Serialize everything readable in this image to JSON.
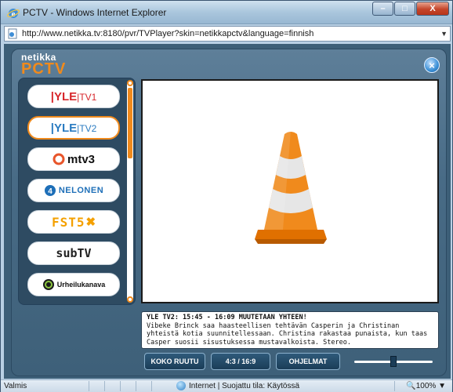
{
  "window": {
    "title": "PCTV - Windows Internet Explorer",
    "min_label": "–",
    "max_label": "□",
    "close_label": "X"
  },
  "addressbar": {
    "url": "http://www.netikka.tv:8180/pvr/TVPlayer?skin=netikkapctv&language=finnish"
  },
  "app": {
    "logo_small": "netikka",
    "logo_big": "PCTV",
    "close_label": "×",
    "channels": [
      {
        "name": "YLE TV1",
        "brand": "YLE",
        "suffix": "TV1",
        "selected": false
      },
      {
        "name": "YLE TV2",
        "brand": "YLE",
        "suffix": "TV2",
        "selected": true
      },
      {
        "name": "MTV3",
        "brand": "mtv3",
        "suffix": "",
        "selected": false
      },
      {
        "name": "NELONEN",
        "brand": "NELONEN",
        "suffix": "",
        "selected": false
      },
      {
        "name": "FST5",
        "brand": "FST5",
        "suffix": "",
        "selected": false
      },
      {
        "name": "SubTV",
        "brand": "subTV",
        "suffix": "",
        "selected": false
      },
      {
        "name": "Urheilukanava",
        "brand": "Urheilukanava",
        "suffix": "",
        "selected": false
      }
    ],
    "epg": {
      "title": "YLE TV2: 15:45 - 16:09 MUUTETAAN YHTEEN!",
      "description": "Vibeke Brinck saa haasteellisen tehtävän Casperin ja Christinan yhteistä kotia suunnitellessaan. Christina rakastaa punaista, kun taas Casper suosii sisustuksessa mustavalkoista. Stereo."
    },
    "controls": {
      "fullscreen_label": "KOKO RUUTU",
      "aspect_label": "4:3 / 16:9",
      "guide_label": "OHJELMAT"
    },
    "volume_level": 0.5
  },
  "status": {
    "left": "Valmis",
    "zone": "Internet | Suojattu tila: Käytössä",
    "zoom": "100%"
  },
  "colors": {
    "accent": "#f08a1c",
    "yle_blue": "#2a7bc1",
    "yle_red": "#d7262b",
    "panel": "#486b86"
  }
}
